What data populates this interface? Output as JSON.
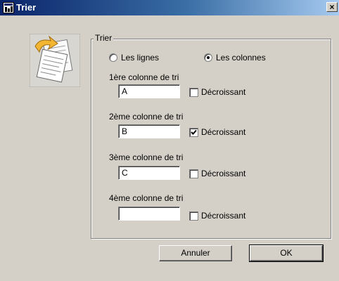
{
  "window": {
    "title": "Trier",
    "close_glyph": "×"
  },
  "icons": {
    "window": "app-window-icon",
    "document": "sort-document-icon"
  },
  "group": {
    "label": "Trier"
  },
  "orientation": {
    "options": [
      {
        "label": "Les lignes",
        "checked": false
      },
      {
        "label": "Les colonnes",
        "checked": true
      }
    ]
  },
  "sort_columns": [
    {
      "label": "1ère colonne de tri",
      "value": "A",
      "descending_label": "Décroissant",
      "descending": false
    },
    {
      "label": "2ème colonne de tri",
      "value": "B",
      "descending_label": "Décroissant",
      "descending": true
    },
    {
      "label": "3ème colonne de tri",
      "value": "C",
      "descending_label": "Décroissant",
      "descending": false
    },
    {
      "label": "4ème colonne de tri",
      "value": "",
      "descending_label": "Décroissant",
      "descending": false
    }
  ],
  "buttons": {
    "cancel_label": "Annuler",
    "ok_label": "OK"
  }
}
